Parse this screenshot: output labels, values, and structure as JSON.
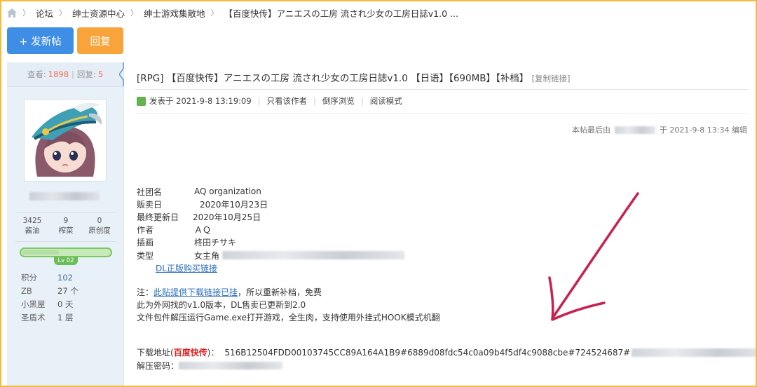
{
  "breadcrumb": {
    "items": [
      "论坛",
      "绅士资源中心",
      "绅士游戏集散地",
      "【百度快传】アニエスの工房 流され少女の工房日誌v1.0 ..."
    ]
  },
  "buttons": {
    "new_post": "+ 发新帖",
    "reply": "回复"
  },
  "sidebar": {
    "views_label": "查看:",
    "views": "1898",
    "replies_label": "回复:",
    "replies": "5",
    "user_stats": [
      {
        "value": "3425",
        "label": "酱油"
      },
      {
        "value": "9",
        "label": "榨菜"
      },
      {
        "value": "0",
        "label": "原创度"
      }
    ],
    "level": "Lv 02",
    "level_progress": 0.42,
    "info": [
      {
        "key": "积分",
        "value": "102",
        "link": true
      },
      {
        "key": "ZB",
        "value": "27 个",
        "link": false
      },
      {
        "key": "小黑屋",
        "value": "0 天",
        "link": false
      },
      {
        "key": "圣盾术",
        "value": "1 层",
        "link": false
      }
    ]
  },
  "post": {
    "title": "[RPG] 【百度快传】アニエスの工房 流され少女の工房日誌v1.0 【日语】【690MB】【补档】",
    "copy_link": "[复制链接]",
    "posted_at": "发表于 2021-9-8 13:19:09",
    "only_author": "只看该作者",
    "reverse": "倒序浏览",
    "read_mode": "阅读模式",
    "last_edit_prefix": "本帖最后由",
    "last_edit_suffix": "于 2021-9-8 13:34 编辑",
    "info": [
      {
        "key": "社团名",
        "value": "AQ organization"
      },
      {
        "key": "贩卖日",
        "value": "2020年10月23日"
      },
      {
        "key": "最终更新日",
        "value": "2020年10月25日"
      },
      {
        "key": "作者",
        "value": "ＡＱ"
      },
      {
        "key": "插画",
        "value": "柊田チサキ"
      },
      {
        "key": "类型",
        "value": "女主角"
      }
    ],
    "dl_link": "DL正版购买链接",
    "note_prefix": "注：",
    "note_link": "此贴提供下载链接已挂",
    "note_suffix": "，所以重新补档，免费",
    "note2": "此为外网找的v1.0版本，DL售卖已更新到2.0",
    "note3": "文件包件解压运行Game.exe打开游戏，全生肉，支持使用外挂式HOOK模式机翻",
    "download_prefix": "下载地址(",
    "download_red": "百度快传",
    "download_suffix": ")：",
    "download_code": "516B12504FDD00103745CC89A164A1B9#6889d08fdc54c0a09b4f5df4c9088cbe#724524687#",
    "password_label": "解压密码："
  },
  "colors": {
    "accent_blue": "#3e8ee5",
    "accent_orange": "#f9a43a",
    "border": "#f2bd3c",
    "annotation": "#c8214f"
  }
}
